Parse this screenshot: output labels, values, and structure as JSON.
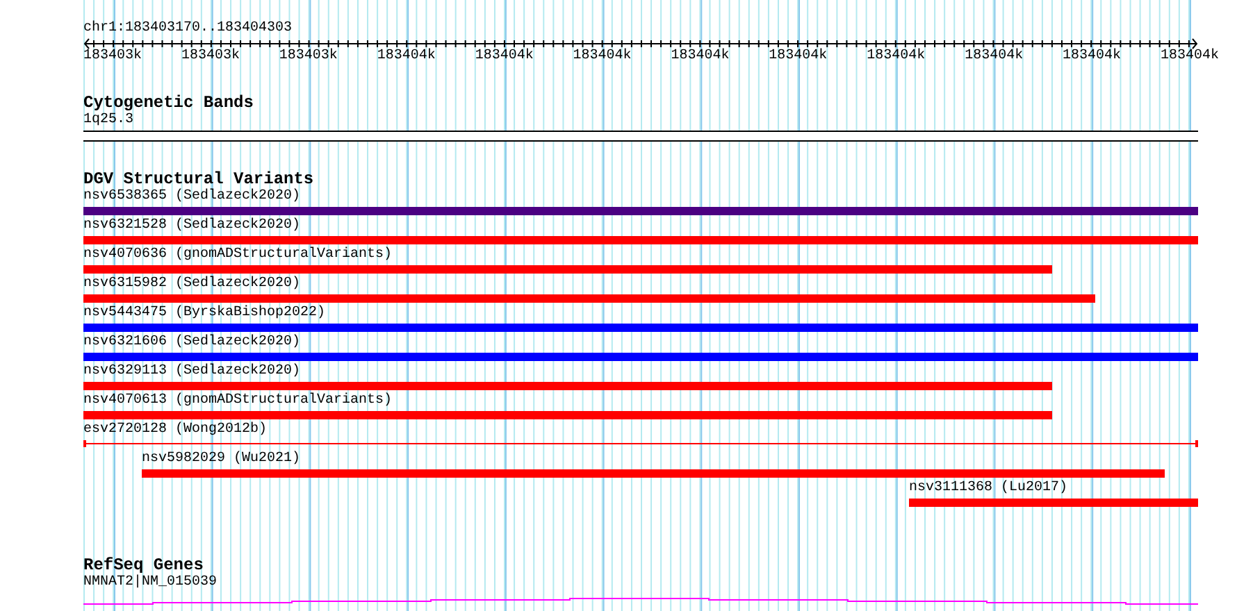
{
  "location": "chr1:183403170..183404303",
  "ruler": {
    "labels": [
      "183403k",
      "183403k",
      "183403k",
      "183404k",
      "183404k",
      "183404k",
      "183404k",
      "183404k",
      "183404k",
      "183404k",
      "183404k",
      "183404k"
    ]
  },
  "cytogenetic_bands": {
    "title": "Cytogenetic Bands",
    "band": "1q25.3"
  },
  "dgv_structural_variants": {
    "title": "DGV Structural Variants",
    "features": [
      {
        "label": "nsv6538365 (Sedlazeck2020)",
        "kind": "thick",
        "color": "#4b0082"
      },
      {
        "label": "nsv6321528 (Sedlazeck2020)",
        "kind": "thick",
        "color": "#ff0000"
      },
      {
        "label": "nsv4070636 (gnomADStructuralVariants)",
        "kind": "thick",
        "color": "#ff0000"
      },
      {
        "label": "nsv6315982 (Sedlazeck2020)",
        "kind": "thick",
        "color": "#ff0000"
      },
      {
        "label": "nsv5443475 (ByrskaBishop2022)",
        "kind": "thick",
        "color": "#0000ff"
      },
      {
        "label": "nsv6321606 (Sedlazeck2020)",
        "kind": "thick",
        "color": "#0000ff"
      },
      {
        "label": "nsv6329113 (Sedlazeck2020)",
        "kind": "thick",
        "color": "#ff0000"
      },
      {
        "label": "nsv4070613 (gnomADStructuralVariants)",
        "kind": "thick",
        "color": "#ff0000"
      },
      {
        "label": "esv2720128 (Wong2012b)",
        "kind": "thin",
        "color": "#ff0000"
      },
      {
        "label": "nsv5982029 (Wu2021)",
        "kind": "thick",
        "color": "#ff0000"
      },
      {
        "label": "nsv3111368 (Lu2017)",
        "kind": "thick",
        "color": "#ff0000"
      }
    ]
  },
  "refseq_genes": {
    "title": "RefSeq Genes",
    "gene": "NMNAT2|NM_015039"
  }
}
